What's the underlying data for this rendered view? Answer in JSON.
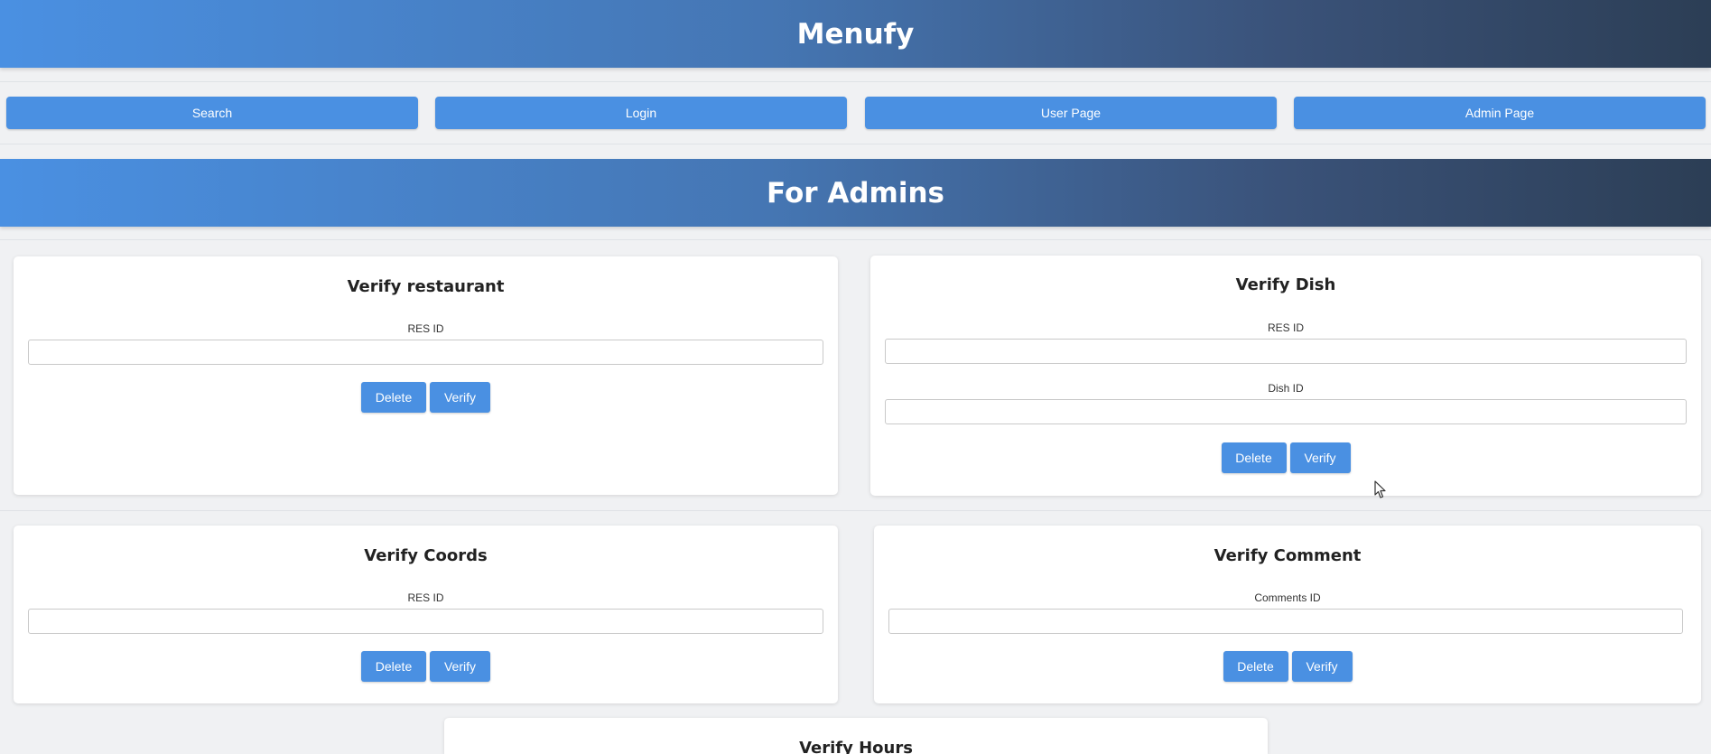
{
  "header": {
    "title": "Menufy"
  },
  "nav": {
    "items": [
      {
        "label": "Search"
      },
      {
        "label": "Login"
      },
      {
        "label": "User Page"
      },
      {
        "label": "Admin Page"
      }
    ]
  },
  "admin_section": {
    "title": "For Admins"
  },
  "cards": {
    "verify_restaurant": {
      "title": "Verify restaurant",
      "fields": [
        {
          "label": "RES ID",
          "value": ""
        }
      ],
      "delete_label": "Delete",
      "verify_label": "Verify"
    },
    "verify_dish": {
      "title": "Verify Dish",
      "fields": [
        {
          "label": "RES ID",
          "value": ""
        },
        {
          "label": "Dish ID",
          "value": ""
        }
      ],
      "delete_label": "Delete",
      "verify_label": "Verify"
    },
    "verify_coords": {
      "title": "Verify Coords",
      "fields": [
        {
          "label": "RES ID",
          "value": ""
        }
      ],
      "delete_label": "Delete",
      "verify_label": "Verify"
    },
    "verify_comment": {
      "title": "Verify Comment",
      "fields": [
        {
          "label": "Comments ID",
          "value": ""
        }
      ],
      "delete_label": "Delete",
      "verify_label": "Verify"
    },
    "verify_hours": {
      "title": "Verify Hours"
    }
  },
  "colors": {
    "accent": "#4a90e2",
    "banner_start": "#4a90e2",
    "banner_end": "#2c3e55",
    "background": "#f0f1f3"
  },
  "icons": {
    "cursor": "mouse-pointer-icon"
  }
}
